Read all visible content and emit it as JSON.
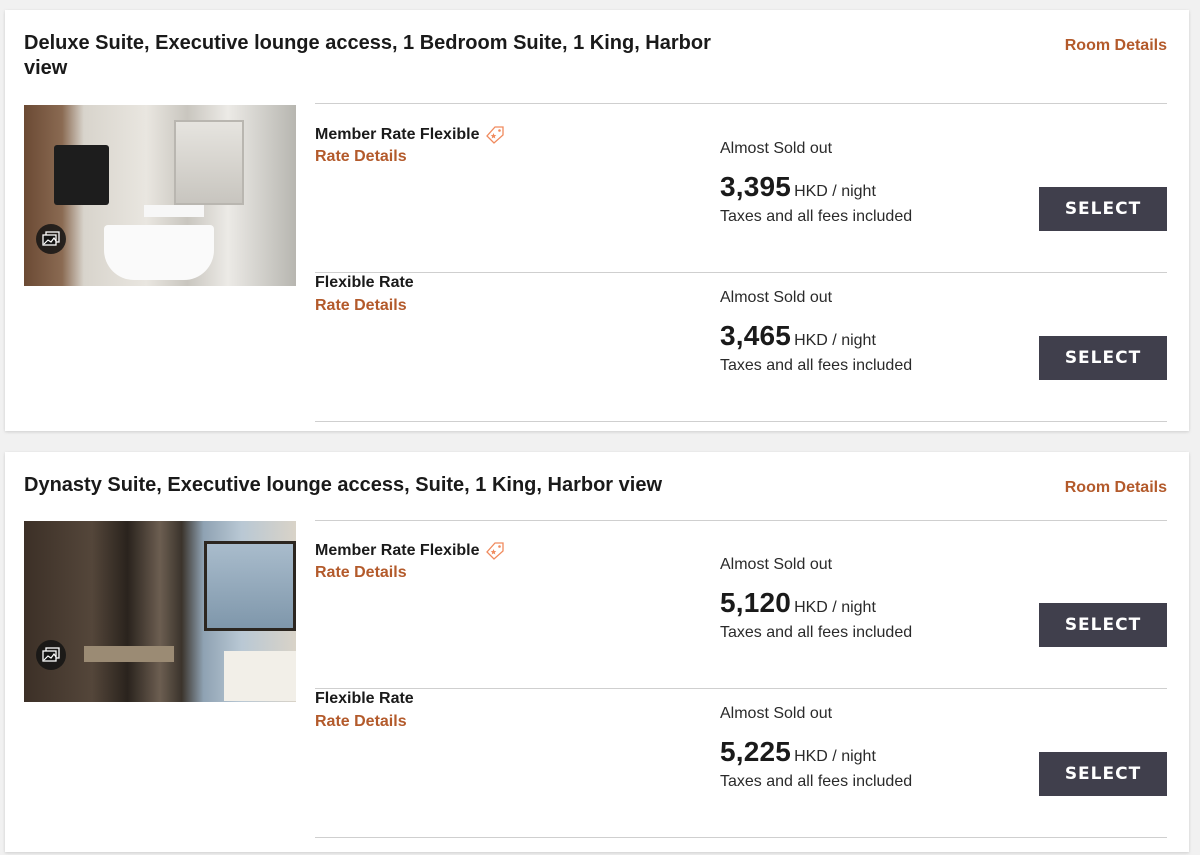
{
  "rooms": [
    {
      "title": "Deluxe Suite, Executive lounge access, 1 Bedroom Suite, 1 King, Harbor view",
      "room_details_label": "Room Details",
      "gallery_icon": "photo-gallery-icon",
      "rates": [
        {
          "name": "Member Rate Flexible",
          "has_tag_icon": true,
          "rate_details_label": "Rate Details",
          "availability": "Almost Sold out",
          "price": "3,395",
          "unit": "HKD / night",
          "taxes": "Taxes and all fees included",
          "select_label": "SELECT"
        },
        {
          "name": "Flexible Rate",
          "has_tag_icon": false,
          "rate_details_label": "Rate Details",
          "availability": "Almost Sold out",
          "price": "3,465",
          "unit": "HKD / night",
          "taxes": "Taxes and all fees included",
          "select_label": "SELECT"
        }
      ]
    },
    {
      "title": "Dynasty Suite, Executive lounge access, Suite, 1 King, Harbor view",
      "room_details_label": "Room Details",
      "gallery_icon": "photo-gallery-icon",
      "rates": [
        {
          "name": "Member Rate Flexible",
          "has_tag_icon": true,
          "rate_details_label": "Rate Details",
          "availability": "Almost Sold out",
          "price": "5,120",
          "unit": "HKD / night",
          "taxes": "Taxes and all fees included",
          "select_label": "SELECT"
        },
        {
          "name": "Flexible Rate",
          "has_tag_icon": false,
          "rate_details_label": "Rate Details",
          "availability": "Almost Sold out",
          "price": "5,225",
          "unit": "HKD / night",
          "taxes": "Taxes and all fees included",
          "select_label": "SELECT"
        }
      ]
    }
  ],
  "colors": {
    "accent": "#b35a2b",
    "button_bg": "#403f4c",
    "tag_icon": "#f08a5d"
  }
}
